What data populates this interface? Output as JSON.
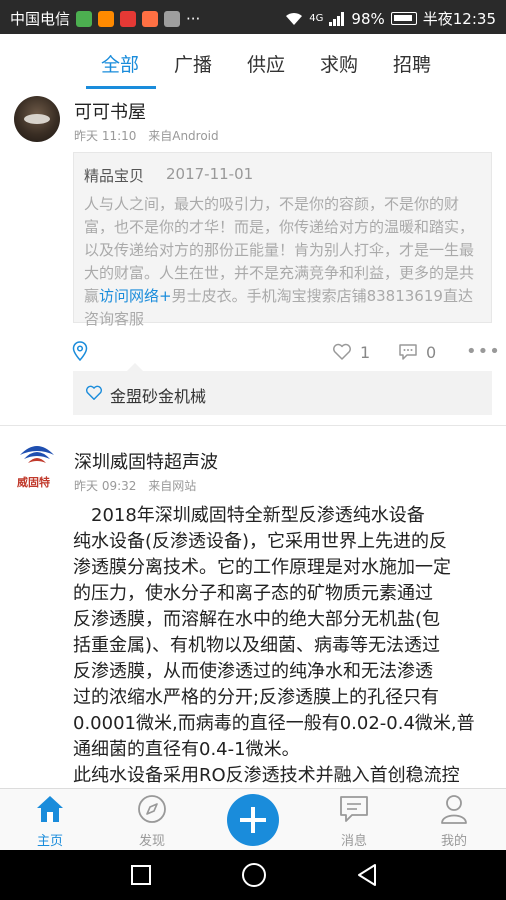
{
  "status_bar": {
    "carrier": "中国电信",
    "battery": "98%",
    "time": "半夜12:35",
    "network": "4G"
  },
  "tabs": [
    {
      "label": "全部",
      "active": true
    },
    {
      "label": "广播",
      "active": false
    },
    {
      "label": "供应",
      "active": false
    },
    {
      "label": "求购",
      "active": false
    },
    {
      "label": "招聘",
      "active": false
    }
  ],
  "post1": {
    "username": "可可书屋",
    "time": "昨天 11:10",
    "source": "来自Android",
    "quote": {
      "title": "精品宝贝",
      "date": "2017-11-01",
      "text_before_link": "人与人之间，最大的吸引力，不是你的容颜，不是你的财富，也不是你的才华！而是，你传递给对方的温暖和踏实，以及传递给对方的那份正能量！肯为别人打伞，才是一生最大的财富。人生在世，并不是充满竞争和利益，更多的是共赢",
      "link_text": "访问网络+",
      "text_after_link": "男士皮衣。手机淘宝搜索店铺83813619直达咨询客服"
    },
    "like_count": "1",
    "comment_count": "0",
    "liked_by": "金盟砂金机械"
  },
  "post2": {
    "username": "深圳威固特超声波",
    "time": "昨天 09:32",
    "source": "来自网站",
    "logo_text": "威固特",
    "body_lines": [
      "　2018年深圳威固特全新型反渗透纯水设备",
      "纯水设备(反渗透设备)，它采用世界上先进的反",
      "渗透膜分离技术。它的工作原理是对水施加一定",
      "的压力，使水分子和离子态的矿物质元素通过",
      "反渗透膜，而溶解在水中的绝大部分无机盐(包",
      "括重金属)、有机物以及细菌、病毒等无法透过",
      "反渗透膜，从而使渗透过的纯净水和无法渗透",
      "过的浓缩水严格的分开;反渗透膜上的孔径只有",
      "0.0001微米,而病毒的直径一般有0.02-0.4微米,普",
      "通细菌的直径有0.4-1微米。",
      "此纯水设备采用RO反渗透技术并融入首创稳流控"
    ]
  },
  "bottom_nav": [
    {
      "label": "主页",
      "icon": "home-icon",
      "active": true
    },
    {
      "label": "发现",
      "icon": "compass-icon",
      "active": false
    },
    {
      "label": "消息",
      "icon": "message-icon",
      "active": false
    },
    {
      "label": "我的",
      "icon": "user-icon",
      "active": false
    }
  ],
  "colors": {
    "accent": "#1a8cdb",
    "logo_red": "#c0392b"
  }
}
